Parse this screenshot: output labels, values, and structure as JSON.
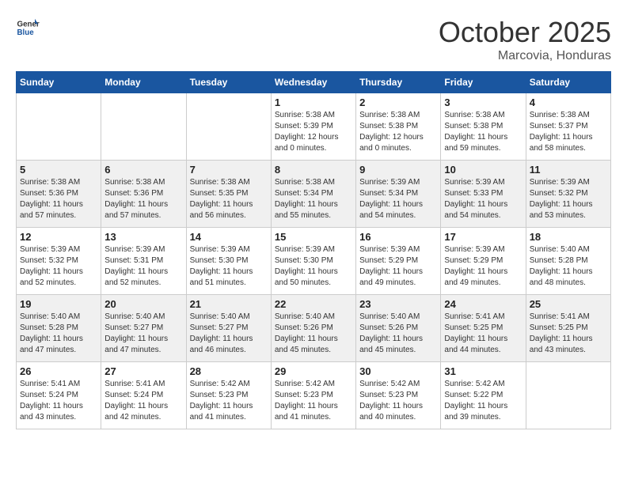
{
  "header": {
    "logo_general": "General",
    "logo_blue": "Blue",
    "month": "October 2025",
    "location": "Marcovia, Honduras"
  },
  "weekdays": [
    "Sunday",
    "Monday",
    "Tuesday",
    "Wednesday",
    "Thursday",
    "Friday",
    "Saturday"
  ],
  "weeks": [
    [
      {
        "day": "",
        "sunrise": "",
        "sunset": "",
        "daylight": ""
      },
      {
        "day": "",
        "sunrise": "",
        "sunset": "",
        "daylight": ""
      },
      {
        "day": "",
        "sunrise": "",
        "sunset": "",
        "daylight": ""
      },
      {
        "day": "1",
        "sunrise": "Sunrise: 5:38 AM",
        "sunset": "Sunset: 5:39 PM",
        "daylight": "Daylight: 12 hours and 0 minutes."
      },
      {
        "day": "2",
        "sunrise": "Sunrise: 5:38 AM",
        "sunset": "Sunset: 5:38 PM",
        "daylight": "Daylight: 12 hours and 0 minutes."
      },
      {
        "day": "3",
        "sunrise": "Sunrise: 5:38 AM",
        "sunset": "Sunset: 5:38 PM",
        "daylight": "Daylight: 11 hours and 59 minutes."
      },
      {
        "day": "4",
        "sunrise": "Sunrise: 5:38 AM",
        "sunset": "Sunset: 5:37 PM",
        "daylight": "Daylight: 11 hours and 58 minutes."
      }
    ],
    [
      {
        "day": "5",
        "sunrise": "Sunrise: 5:38 AM",
        "sunset": "Sunset: 5:36 PM",
        "daylight": "Daylight: 11 hours and 57 minutes."
      },
      {
        "day": "6",
        "sunrise": "Sunrise: 5:38 AM",
        "sunset": "Sunset: 5:36 PM",
        "daylight": "Daylight: 11 hours and 57 minutes."
      },
      {
        "day": "7",
        "sunrise": "Sunrise: 5:38 AM",
        "sunset": "Sunset: 5:35 PM",
        "daylight": "Daylight: 11 hours and 56 minutes."
      },
      {
        "day": "8",
        "sunrise": "Sunrise: 5:38 AM",
        "sunset": "Sunset: 5:34 PM",
        "daylight": "Daylight: 11 hours and 55 minutes."
      },
      {
        "day": "9",
        "sunrise": "Sunrise: 5:39 AM",
        "sunset": "Sunset: 5:34 PM",
        "daylight": "Daylight: 11 hours and 54 minutes."
      },
      {
        "day": "10",
        "sunrise": "Sunrise: 5:39 AM",
        "sunset": "Sunset: 5:33 PM",
        "daylight": "Daylight: 11 hours and 54 minutes."
      },
      {
        "day": "11",
        "sunrise": "Sunrise: 5:39 AM",
        "sunset": "Sunset: 5:32 PM",
        "daylight": "Daylight: 11 hours and 53 minutes."
      }
    ],
    [
      {
        "day": "12",
        "sunrise": "Sunrise: 5:39 AM",
        "sunset": "Sunset: 5:32 PM",
        "daylight": "Daylight: 11 hours and 52 minutes."
      },
      {
        "day": "13",
        "sunrise": "Sunrise: 5:39 AM",
        "sunset": "Sunset: 5:31 PM",
        "daylight": "Daylight: 11 hours and 52 minutes."
      },
      {
        "day": "14",
        "sunrise": "Sunrise: 5:39 AM",
        "sunset": "Sunset: 5:30 PM",
        "daylight": "Daylight: 11 hours and 51 minutes."
      },
      {
        "day": "15",
        "sunrise": "Sunrise: 5:39 AM",
        "sunset": "Sunset: 5:30 PM",
        "daylight": "Daylight: 11 hours and 50 minutes."
      },
      {
        "day": "16",
        "sunrise": "Sunrise: 5:39 AM",
        "sunset": "Sunset: 5:29 PM",
        "daylight": "Daylight: 11 hours and 49 minutes."
      },
      {
        "day": "17",
        "sunrise": "Sunrise: 5:39 AM",
        "sunset": "Sunset: 5:29 PM",
        "daylight": "Daylight: 11 hours and 49 minutes."
      },
      {
        "day": "18",
        "sunrise": "Sunrise: 5:40 AM",
        "sunset": "Sunset: 5:28 PM",
        "daylight": "Daylight: 11 hours and 48 minutes."
      }
    ],
    [
      {
        "day": "19",
        "sunrise": "Sunrise: 5:40 AM",
        "sunset": "Sunset: 5:28 PM",
        "daylight": "Daylight: 11 hours and 47 minutes."
      },
      {
        "day": "20",
        "sunrise": "Sunrise: 5:40 AM",
        "sunset": "Sunset: 5:27 PM",
        "daylight": "Daylight: 11 hours and 47 minutes."
      },
      {
        "day": "21",
        "sunrise": "Sunrise: 5:40 AM",
        "sunset": "Sunset: 5:27 PM",
        "daylight": "Daylight: 11 hours and 46 minutes."
      },
      {
        "day": "22",
        "sunrise": "Sunrise: 5:40 AM",
        "sunset": "Sunset: 5:26 PM",
        "daylight": "Daylight: 11 hours and 45 minutes."
      },
      {
        "day": "23",
        "sunrise": "Sunrise: 5:40 AM",
        "sunset": "Sunset: 5:26 PM",
        "daylight": "Daylight: 11 hours and 45 minutes."
      },
      {
        "day": "24",
        "sunrise": "Sunrise: 5:41 AM",
        "sunset": "Sunset: 5:25 PM",
        "daylight": "Daylight: 11 hours and 44 minutes."
      },
      {
        "day": "25",
        "sunrise": "Sunrise: 5:41 AM",
        "sunset": "Sunset: 5:25 PM",
        "daylight": "Daylight: 11 hours and 43 minutes."
      }
    ],
    [
      {
        "day": "26",
        "sunrise": "Sunrise: 5:41 AM",
        "sunset": "Sunset: 5:24 PM",
        "daylight": "Daylight: 11 hours and 43 minutes."
      },
      {
        "day": "27",
        "sunrise": "Sunrise: 5:41 AM",
        "sunset": "Sunset: 5:24 PM",
        "daylight": "Daylight: 11 hours and 42 minutes."
      },
      {
        "day": "28",
        "sunrise": "Sunrise: 5:42 AM",
        "sunset": "Sunset: 5:23 PM",
        "daylight": "Daylight: 11 hours and 41 minutes."
      },
      {
        "day": "29",
        "sunrise": "Sunrise: 5:42 AM",
        "sunset": "Sunset: 5:23 PM",
        "daylight": "Daylight: 11 hours and 41 minutes."
      },
      {
        "day": "30",
        "sunrise": "Sunrise: 5:42 AM",
        "sunset": "Sunset: 5:23 PM",
        "daylight": "Daylight: 11 hours and 40 minutes."
      },
      {
        "day": "31",
        "sunrise": "Sunrise: 5:42 AM",
        "sunset": "Sunset: 5:22 PM",
        "daylight": "Daylight: 11 hours and 39 minutes."
      },
      {
        "day": "",
        "sunrise": "",
        "sunset": "",
        "daylight": ""
      }
    ]
  ]
}
